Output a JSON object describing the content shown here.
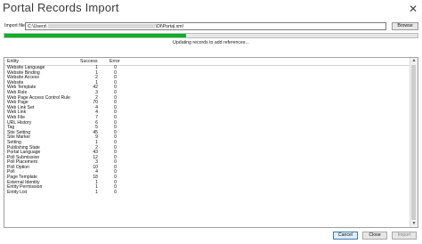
{
  "window": {
    "title": "Portal Records Import",
    "close_glyph": "✕"
  },
  "file": {
    "label": "Import file",
    "value_prefix": "C:\\Users\\",
    "value_suffix": "\\DI\\Portal.xml",
    "browse_label": "Browse"
  },
  "progress": {
    "fraction": 0.44,
    "status_text": "Updating records to add references..."
  },
  "grid": {
    "headers": {
      "entity": "Entity",
      "success": "Success",
      "error": "Error"
    },
    "rows": [
      {
        "entity": "Website Language",
        "success": "1",
        "error": "0"
      },
      {
        "entity": "Website Binding",
        "success": "1",
        "error": "0"
      },
      {
        "entity": "Website Access",
        "success": "2",
        "error": "0"
      },
      {
        "entity": "Website",
        "success": "1",
        "error": "0"
      },
      {
        "entity": "Web Template",
        "success": "42",
        "error": "0"
      },
      {
        "entity": "Web Role",
        "success": "3",
        "error": "0"
      },
      {
        "entity": "Web Page Access Control Rule",
        "success": "2",
        "error": "0"
      },
      {
        "entity": "Web Page",
        "success": "70",
        "error": "0"
      },
      {
        "entity": "Web Link Set",
        "success": "4",
        "error": "0"
      },
      {
        "entity": "Web Link",
        "success": "4",
        "error": "0"
      },
      {
        "entity": "Web File",
        "success": "7",
        "error": "0"
      },
      {
        "entity": "URL History",
        "success": "6",
        "error": "0"
      },
      {
        "entity": "Tag",
        "success": "5",
        "error": "0"
      },
      {
        "entity": "Site Setting",
        "success": "45",
        "error": "0"
      },
      {
        "entity": "Site Marker",
        "success": "9",
        "error": "0"
      },
      {
        "entity": "Setting",
        "success": "1",
        "error": "0"
      },
      {
        "entity": "Publishing State",
        "success": "2",
        "error": "0"
      },
      {
        "entity": "Portal Language",
        "success": "43",
        "error": "0"
      },
      {
        "entity": "Poll Submission",
        "success": "12",
        "error": "0"
      },
      {
        "entity": "Poll Placement",
        "success": "3",
        "error": "0"
      },
      {
        "entity": "Poll Option",
        "success": "10",
        "error": "0"
      },
      {
        "entity": "Poll",
        "success": "4",
        "error": "0"
      },
      {
        "entity": "Page Template",
        "success": "18",
        "error": "0"
      },
      {
        "entity": "External Identity",
        "success": "1",
        "error": "0"
      },
      {
        "entity": "Entity Permission",
        "success": "1",
        "error": "0"
      },
      {
        "entity": "Entity List",
        "success": "1",
        "error": "0"
      }
    ]
  },
  "buttons": {
    "cancel": "Cancel",
    "close": "Close",
    "import": "Import"
  },
  "scroll": {
    "up_glyph": "▲",
    "down_glyph": "▼"
  }
}
